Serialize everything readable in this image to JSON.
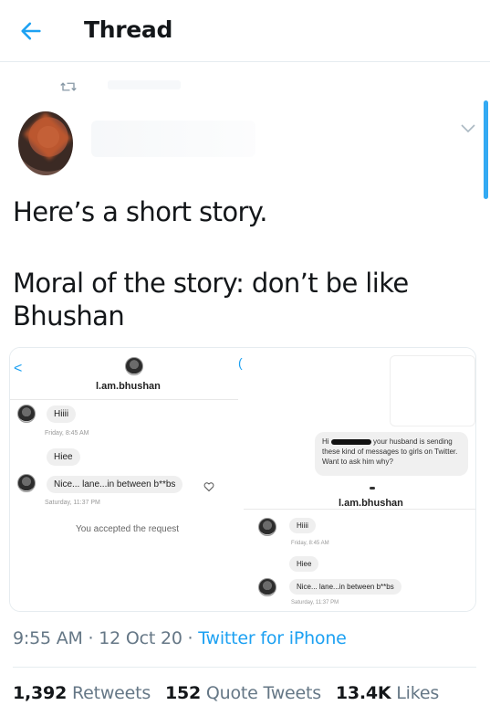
{
  "header": {
    "title": "Thread"
  },
  "tweet": {
    "line1": "Here’s a short story.",
    "line2": "Moral of the story: don’t be like",
    "line3": "Bhushan"
  },
  "media": {
    "left": {
      "username": "l.am.bhushan",
      "msg1": "Hiiii",
      "ts1": "Friday, 8:45 AM",
      "msg2": "Hiee",
      "msg3": "Nice... lane...in between b**bs",
      "ts2": "Saturday, 11:37 PM",
      "accepted": "You accepted the request"
    },
    "right": {
      "reply_prefix": "Hi",
      "reply_text": "your husband is sending these kind of messages to girls on Twitter. Want to ask him why?",
      "username": "l.am.bhushan",
      "msg1": "Hiiii",
      "ts1": "Friday, 8:45 AM",
      "msg2": "Hiee",
      "msg3": "Nice... lane...in between b**bs",
      "ts2": "Saturday, 11:37 PM"
    }
  },
  "meta": {
    "time": "9:55 AM",
    "sep1": " · ",
    "date": "12 Oct 20",
    "sep2": " · ",
    "source": "Twitter for iPhone"
  },
  "stats": {
    "retweets_count": "1,392",
    "retweets_label": "Retweets",
    "quotes_count": "152",
    "quotes_label": "Quote Tweets",
    "likes_count": "13.4K",
    "likes_label": "Likes"
  },
  "colors": {
    "accent": "#1da1f2",
    "secondary": "#657786",
    "text": "#14171a"
  },
  "icons": {
    "back": "arrow-left-icon",
    "retweet": "retweet-icon",
    "more": "chevron-down-icon",
    "like": "heart-icon"
  }
}
